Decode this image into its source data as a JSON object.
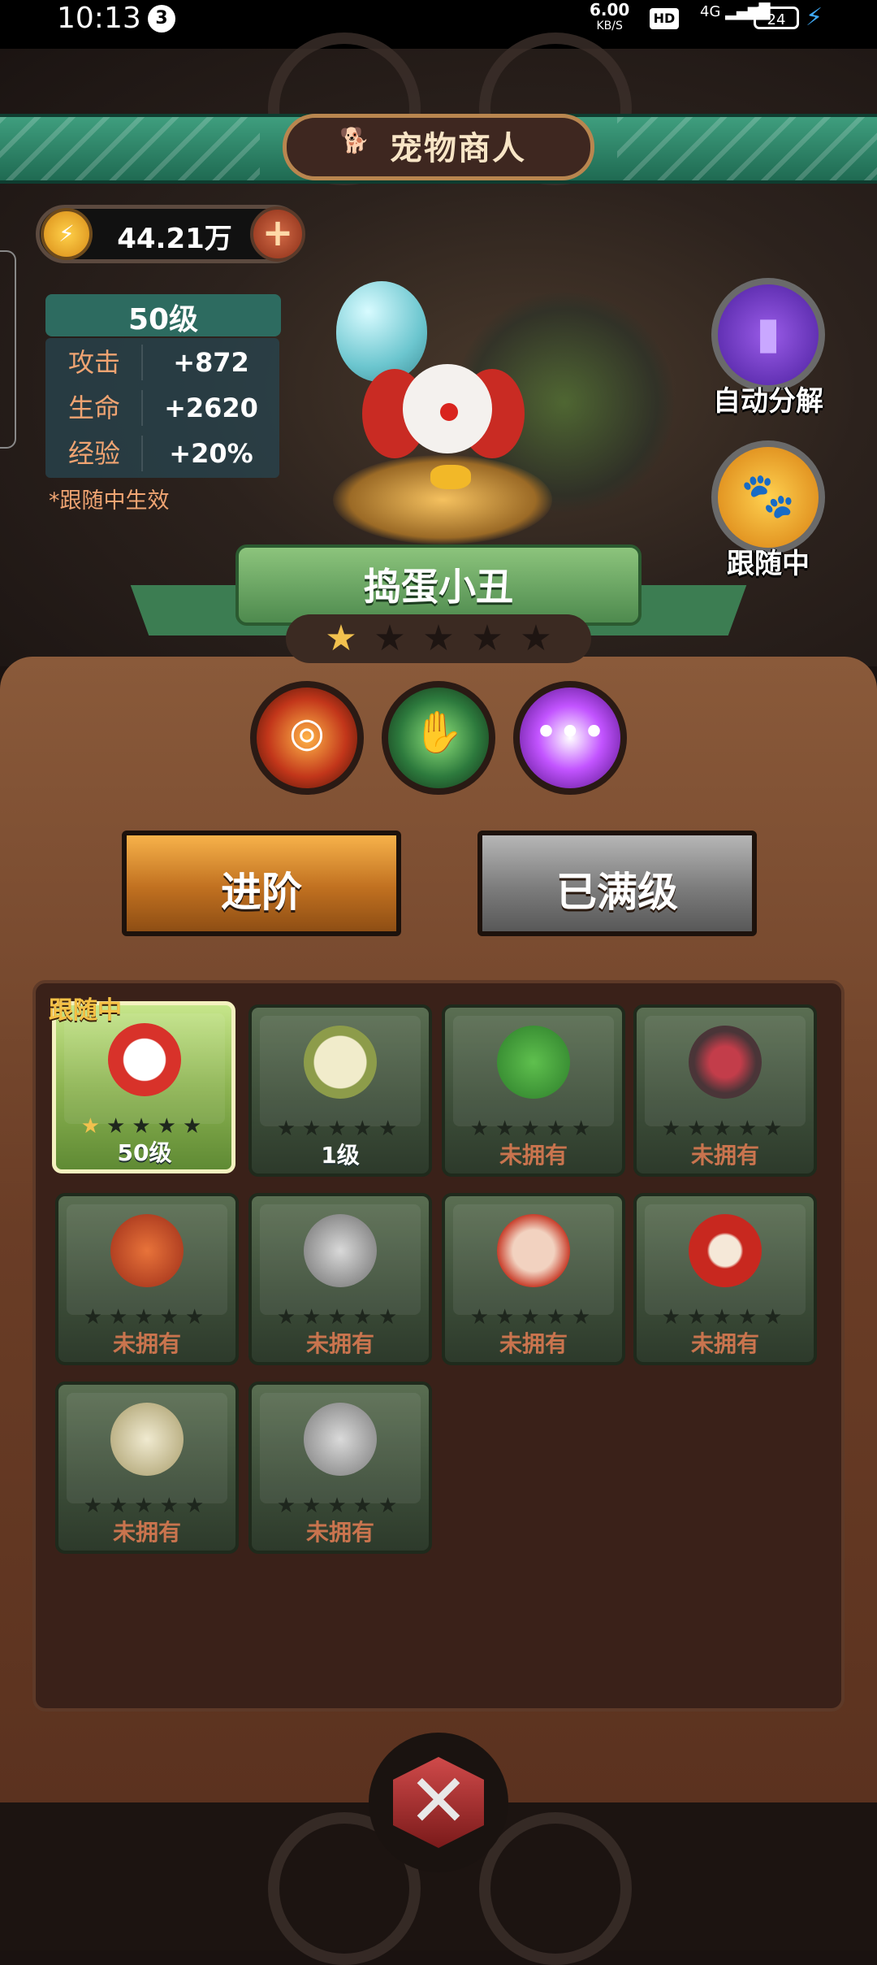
{
  "status_bar": {
    "time": "10:13",
    "notification_count": "3",
    "net_speed": "6.00",
    "net_speed_unit": "KB/S",
    "hd_label": "HD",
    "network": "4G",
    "battery": "24"
  },
  "header": {
    "title": "宠物商人",
    "icon": "dog-icon"
  },
  "currency": {
    "amount": "44.21万",
    "add_icon": "plus-icon"
  },
  "stats": {
    "level": "50级",
    "rows": [
      {
        "label": "攻击",
        "value": "+872"
      },
      {
        "label": "生命",
        "value": "+2620"
      },
      {
        "label": "经验",
        "value": "+20%"
      }
    ],
    "note": "*跟随中生效"
  },
  "side_buttons": {
    "auto_decompose": "自动分解",
    "following": "跟随中"
  },
  "pet": {
    "name": "捣蛋小丑",
    "stars_filled": 1,
    "stars_total": 5
  },
  "skills": [
    {
      "icon": "fire-vortex-icon"
    },
    {
      "icon": "green-claw-icon"
    },
    {
      "icon": "speech-bubble-icon"
    }
  ],
  "buttons": {
    "advance": "进阶",
    "maxed": "已满级"
  },
  "grid": {
    "follow_tag": "跟随中",
    "pets": [
      {
        "id": "clown",
        "label": "50级",
        "owned": true,
        "active": true,
        "stars": 1
      },
      {
        "id": "deer-skull",
        "label": "1级",
        "owned": true,
        "active": false,
        "stars": 0
      },
      {
        "id": "green-frog",
        "label": "未拥有",
        "owned": false,
        "active": false,
        "stars": 0
      },
      {
        "id": "mimic-chest",
        "label": "未拥有",
        "owned": false,
        "active": false,
        "stars": 0
      },
      {
        "id": "red-dragon",
        "label": "未拥有",
        "owned": false,
        "active": false,
        "stars": 0
      },
      {
        "id": "knight",
        "label": "未拥有",
        "owned": false,
        "active": false,
        "stars": 0
      },
      {
        "id": "chicken",
        "label": "未拥有",
        "owned": false,
        "active": false,
        "stars": 0
      },
      {
        "id": "daruma",
        "label": "未拥有",
        "owned": false,
        "active": false,
        "stars": 0
      },
      {
        "id": "chick",
        "label": "未拥有",
        "owned": false,
        "active": false,
        "stars": 0
      },
      {
        "id": "gauntlet",
        "label": "未拥有",
        "owned": false,
        "active": false,
        "stars": 0
      }
    ]
  },
  "close_icon": "close-x-icon",
  "colors": {
    "owned_text": "#ffffff",
    "unowned_text": "#c9744e",
    "star_on": "#f2c14e",
    "accent_green": "#3f9e7e"
  }
}
